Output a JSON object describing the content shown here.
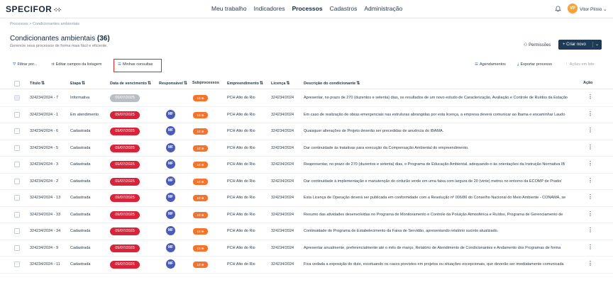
{
  "header": {
    "logo": "SPECIFOR",
    "logo_mark": "⁖⁘",
    "nav": [
      "Meu trabalho",
      "Indicadores",
      "Processos",
      "Cadastros",
      "Administração"
    ],
    "active_nav": "Processos",
    "avatar_initials": "VP",
    "user_name": "Vitor Plínio ⌄"
  },
  "page": {
    "breadcrumb": "Processos  >  Condicionantes ambientais",
    "title": "Condicionantes ambientais",
    "count": "(36)",
    "subtitle": "Gerencie seus processos de forma mais fácil e eficiente.",
    "permissions_label": "Permissões",
    "create_label": "+ Criar novo"
  },
  "toolbar": {
    "filter": "Filtrar por...",
    "edit_fields": "Editar campos da listagem",
    "my_queries": "Minhas consultas",
    "schedules": "Agendamentos",
    "export": "Exportar processo",
    "bulk_actions": "Ações em lote"
  },
  "table": {
    "columns": [
      "Título",
      "Etapa",
      "Data de vencimento",
      "Responsável",
      "Subprocessos",
      "Empreendimento",
      "Licença",
      "Descrição do condicionante",
      "Ação"
    ],
    "rows": [
      {
        "titulo": "324234/2024 - 7",
        "etapa": "Informativa",
        "vencimento": "09/07/2025",
        "responsavel": "",
        "sub": "10 ⊕",
        "empreendimento": "PCH Alto do Rio",
        "licenca": "324234/2024",
        "descricao": "Apresentar, no prazo de 270 (duzentos e setenta) dias, os resultados de um novo estudo de Caracterização, Avaliação e Controle de Ruídos da Estação"
      },
      {
        "titulo": "324234/2024 - 1",
        "etapa": "Em atendimento",
        "vencimento": "09/07/2025",
        "responsavel": "MF",
        "sub": "10 ⊕",
        "empreendimento": "PCH Alto do Rio",
        "licenca": "324234/2024",
        "descricao": "Em caso de realização de obras emergenciais nas estruturas abrangidas por esta licença, a empresa deverá comunicar ao Ibama e encaminhar Laudo"
      },
      {
        "titulo": "324234/2024 - 6",
        "etapa": "Cadastrada",
        "vencimento": "09/07/2025",
        "responsavel": "MF",
        "sub": "10 ⊕",
        "empreendimento": "PCH Alto do Rio",
        "licenca": "324234/2024",
        "descricao": "Quaisquer alterações de Projeto deverão ser precedidas de anuência do IBAMA."
      },
      {
        "titulo": "324234/2024 - 5",
        "etapa": "Cadastrada",
        "vencimento": "09/07/2025",
        "responsavel": "MF",
        "sub": "10 ⊕",
        "empreendimento": "PCH Alto do Rio",
        "licenca": "324234/2024",
        "descricao": "Dar continuidade às tratativas para execução da Compensação Ambiental do empreendimento."
      },
      {
        "titulo": "324234/2024 - 3",
        "etapa": "Cadastrada",
        "vencimento": "09/07/2025",
        "responsavel": "MF",
        "sub": "10 ⊕",
        "empreendimento": "PCH Alto do Rio",
        "licenca": "324234/2024",
        "descricao": "Reapresentar, no prazo de 270 (duzentos e setenta) dias, o Programa de Educação Ambiental, adequando-o às orientações da Instrução Normativa IB"
      },
      {
        "titulo": "324234/2024 - 2",
        "etapa": "Cadastrada",
        "vencimento": "09/07/2025",
        "responsavel": "MF",
        "sub": "10 ⊕",
        "empreendimento": "PCH Alto do Rio",
        "licenca": "324234/2024",
        "descricao": "Dar continuidade à implementação e manutenção do cinturão verde em uma faixa com largura de 20 (vinte) metros no entorno da ECOMP de Prado/"
      },
      {
        "titulo": "324234/2024 - 13",
        "etapa": "Cadastrada",
        "vencimento": "09/07/2025",
        "responsavel": "MF",
        "sub": "10 ⊕",
        "empreendimento": "PCH Alto do Rio",
        "licenca": "324234/2024",
        "descricao": "Esta Licença de Operação deverá ser publicada em conformidade com a Resolução nº 006/86 do Conselho Nacional do Meio Ambiente - CONAMA, se"
      },
      {
        "titulo": "324234/2024 - 33",
        "etapa": "Cadastrada",
        "vencimento": "09/07/2025",
        "responsavel": "MF",
        "sub": "10 ⊕",
        "empreendimento": "PCH Alto do Rio",
        "licenca": "324234/2024",
        "descricao": "Resumo das atividades desenvolvidas no Programa de Monitoramento e Controle da Poluição Atmosférica e Ruídos, Programa de Gerenciamento de"
      },
      {
        "titulo": "324234/2024 - 34",
        "etapa": "Cadastrada",
        "vencimento": "09/07/2025",
        "responsavel": "MF",
        "sub": "10 ⊕",
        "empreendimento": "PCH Alto do Rio",
        "licenca": "324234/2024",
        "descricao": "Continuidade do Programa de Estabelecimento da Faixa de Servidão, apresentando relatório sucinto atualizado."
      },
      {
        "titulo": "324234/2024 - 9",
        "etapa": "Cadastrada",
        "vencimento": "09/07/2025",
        "responsavel": "MF",
        "sub": "10 ⊕",
        "empreendimento": "PCH Alto do Rio",
        "licenca": "324234/2024",
        "descricao": "Apresentar anualmente, preferencialmente até o mês de março, Relatório de Atendimento de Condicionantes e Andamento dos Programas de forma"
      },
      {
        "titulo": "324234/2024 - 11",
        "etapa": "Cadastrada",
        "vencimento": "09/07/2025",
        "responsavel": "MF",
        "sub": "10 ⊕",
        "empreendimento": "PCH Alto do Rio",
        "licenca": "324234/2024",
        "descricao": "Fica vedada a exposição do duto, excetuando os casos previstos em projetos ou situações excepcionais, que deverão ser imediatamente comunicada"
      }
    ]
  },
  "colors": {
    "primary": "#1f3a56",
    "overdue": "#d8233a",
    "subprocess": "#f5732a",
    "avatar": "#4a5bb8",
    "highlight": "#e0262a"
  }
}
